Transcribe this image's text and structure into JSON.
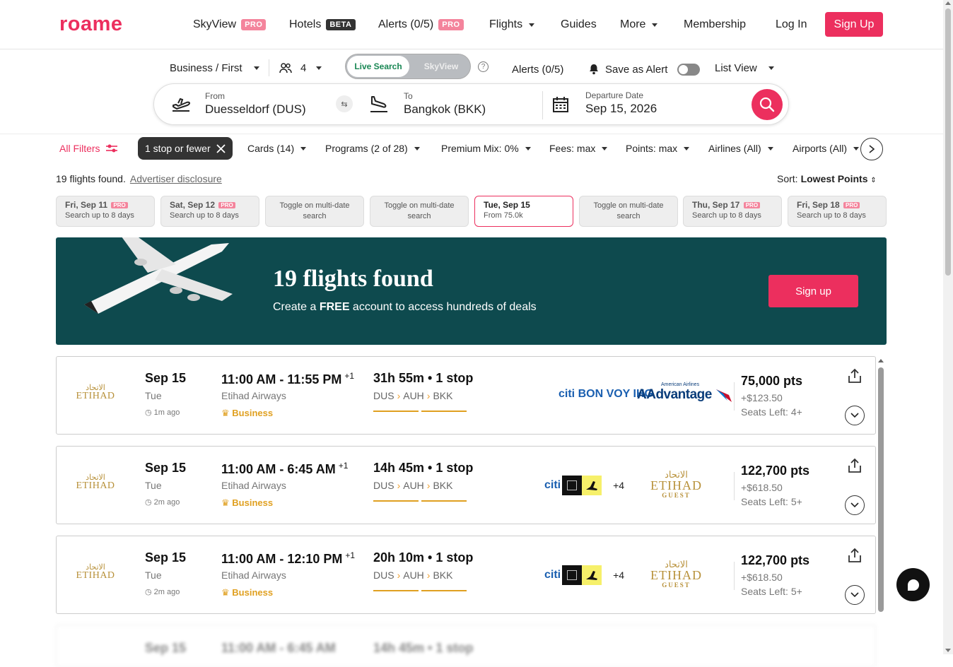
{
  "nav": {
    "logo": "roame",
    "skyview": "SkyView",
    "skyview_badge": "PRO",
    "hotels": "Hotels",
    "hotels_badge": "BETA",
    "alerts": "Alerts (0/5)",
    "alerts_badge": "PRO",
    "flights": "Flights",
    "guides": "Guides",
    "more": "More",
    "membership": "Membership",
    "login": "Log In",
    "signup": "Sign Up"
  },
  "search": {
    "cabin": "Business / First",
    "passengers": "4",
    "live_search": "Live Search",
    "skyview": "SkyView",
    "alerts": "Alerts (0/5)",
    "save_alert": "Save as Alert",
    "view": "List View",
    "from_label": "From",
    "from_value": "Duesseldorf (DUS)",
    "to_label": "To",
    "to_value": "Bangkok (BKK)",
    "date_label": "Departure Date",
    "date_value": "Sep 15, 2026"
  },
  "filters": {
    "all": "All Filters",
    "stop_chip": "1 stop or fewer",
    "cards": "Cards (14)",
    "programs": "Programs (2 of 28)",
    "premium": "Premium Mix: 0%",
    "fees": "Fees: max",
    "points": "Points: max",
    "airlines": "Airlines (All)",
    "airports": "Airports (All)"
  },
  "results": {
    "found": "19 flights found.",
    "disclosure": "Advertiser disclosure",
    "sort_label": "Sort:",
    "sort_value": "Lowest Points"
  },
  "dates": [
    {
      "title": "Fri, Sep 11",
      "badge": "PRO",
      "sub": "Search up to 8 days"
    },
    {
      "title": "Sat, Sep 12",
      "badge": "PRO",
      "sub": "Search up to 8 days"
    },
    {
      "title": "Toggle on multi-date search"
    },
    {
      "title": "Toggle on multi-date search"
    },
    {
      "title": "Tue, Sep 15",
      "sub": "From 75.0k"
    },
    {
      "title": "Toggle on multi-date search"
    },
    {
      "title": "Thu, Sep 17",
      "badge": "PRO",
      "sub": "Search up to 8 days"
    },
    {
      "title": "Fri, Sep 18",
      "badge": "PRO",
      "sub": "Search up to 8 days"
    }
  ],
  "banner": {
    "title": "19 flights found",
    "text_pre": "Create a ",
    "text_bold": "FREE",
    "text_post": " account to access hundreds of deals",
    "button": "Sign up"
  },
  "flights": [
    {
      "airline_ar": "الاتحاد",
      "airline_logo": "ETIHAD",
      "date": "Sep 15",
      "dow": "Tue",
      "ago": "1m ago",
      "time": "11:00 AM - 11:55 PM",
      "plus": "+1",
      "airline": "Etihad Airways",
      "cabin": "Business",
      "duration": "31h 55m • 1 stop",
      "route": [
        "DUS",
        "AUH",
        "BKK"
      ],
      "cards": "citi  BON VOY  IHG",
      "program": "AAdvantage",
      "program_small": "American Airlines",
      "points": "75,000 pts",
      "fee": "+$123.50",
      "seats": "Seats Left: 4+"
    },
    {
      "airline_ar": "الاتحاد",
      "airline_logo": "ETIHAD",
      "date": "Sep 15",
      "dow": "Tue",
      "ago": "2m ago",
      "time": "11:00 AM - 6:45 AM",
      "plus": "+1",
      "airline": "Etihad Airways",
      "cabin": "Business",
      "duration": "14h 45m • 1 stop",
      "route": [
        "DUS",
        "AUH",
        "BKK"
      ],
      "cards": "citi",
      "more_cards": "+4",
      "program_ar": "الاتحاد",
      "program": "ETIHAD",
      "program_sub": "GUEST",
      "points": "122,700 pts",
      "fee": "+$618.50",
      "seats": "Seats Left: 5+"
    },
    {
      "airline_ar": "الاتحاد",
      "airline_logo": "ETIHAD",
      "date": "Sep 15",
      "dow": "Tue",
      "ago": "2m ago",
      "time": "11:00 AM - 12:10 PM",
      "plus": "+1",
      "airline": "Etihad Airways",
      "cabin": "Business",
      "duration": "20h 10m • 1 stop",
      "route": [
        "DUS",
        "AUH",
        "BKK"
      ],
      "cards": "citi",
      "more_cards": "+4",
      "program_ar": "الاتحاد",
      "program": "ETIHAD",
      "program_sub": "GUEST",
      "points": "122,700 pts",
      "fee": "+$618.50",
      "seats": "Seats Left: 5+"
    }
  ],
  "blurred": {
    "date": "Sep 15",
    "time": "11:00 AM - 6:45 AM",
    "duration": "14h 45m • 1 stop"
  },
  "colors": {
    "brand": "#ec2f5e",
    "banner": "#0e4a4e",
    "gold": "#b8913a",
    "cabin": "#e0a020"
  }
}
